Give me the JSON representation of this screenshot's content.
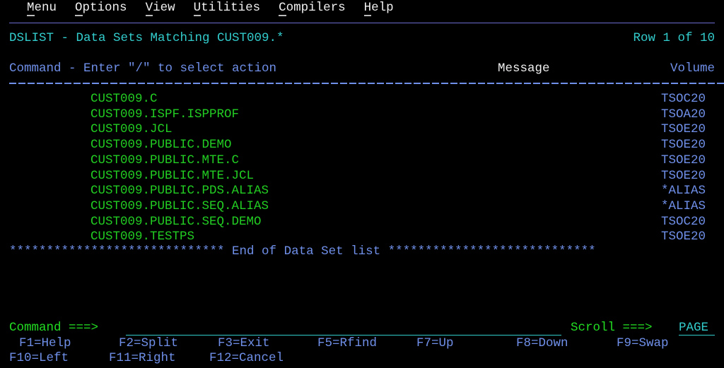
{
  "menu": [
    {
      "first": "M",
      "rest": "enu"
    },
    {
      "first": "O",
      "rest": "ptions"
    },
    {
      "first": "V",
      "rest": "iew"
    },
    {
      "first": "U",
      "rest": "tilities"
    },
    {
      "first": "C",
      "rest": "ompilers"
    },
    {
      "first": "H",
      "rest": "elp"
    }
  ],
  "header": {
    "title": "DSLIST - Data Sets Matching CUST009.*",
    "row_info": "Row 1 of 10",
    "command_label": "Command - Enter \"/\" to select action",
    "message_label": "Message",
    "volume_label": "Volume"
  },
  "datasets": [
    {
      "name": "CUST009.C",
      "volume": "TSOC20"
    },
    {
      "name": "CUST009.ISPF.ISPPROF",
      "volume": "TSOA20"
    },
    {
      "name": "CUST009.JCL",
      "volume": "TSOE20"
    },
    {
      "name": "CUST009.PUBLIC.DEMO",
      "volume": "TSOE20"
    },
    {
      "name": "CUST009.PUBLIC.MTE.C",
      "volume": "TSOE20"
    },
    {
      "name": "CUST009.PUBLIC.MTE.JCL",
      "volume": "TSOE20"
    },
    {
      "name": "CUST009.PUBLIC.PDS.ALIAS",
      "volume": "*ALIAS"
    },
    {
      "name": "CUST009.PUBLIC.SEQ.ALIAS",
      "volume": "*ALIAS"
    },
    {
      "name": "CUST009.PUBLIC.SEQ.DEMO",
      "volume": "TSOC20"
    },
    {
      "name": "CUST009.TESTPS",
      "volume": "TSOE20"
    }
  ],
  "end_marker": "***************************** End of Data Set list ****************************",
  "footer": {
    "command_prompt": "Command ===>",
    "command_value": "",
    "scroll_prompt": "Scroll ===>",
    "scroll_value": "PAGE",
    "pf_row1": [
      "F1=Help",
      "F2=Split",
      "F3=Exit",
      "F5=Rfind",
      "F7=Up",
      "F8=Down",
      "F9=Swap"
    ],
    "pf_row2": [
      "F10=Left",
      "F11=Right",
      "F12=Cancel"
    ]
  }
}
